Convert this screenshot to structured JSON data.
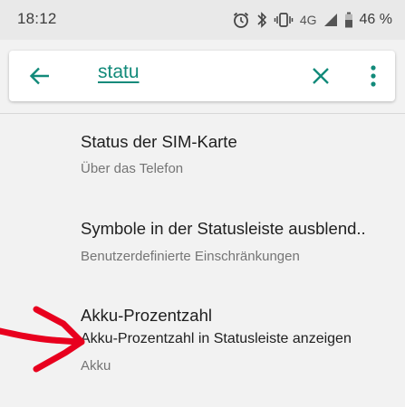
{
  "status_bar": {
    "time": "18:12",
    "icons": [
      "alarm-icon",
      "bluetooth-icon",
      "vibrate-icon",
      "signal-icon",
      "battery-icon"
    ],
    "network": "4G",
    "battery": "46 %"
  },
  "search": {
    "back_icon": "arrow-left-icon",
    "query": "statu",
    "clear_icon": "close-icon",
    "menu_icon": "more-vert-icon"
  },
  "results": [
    {
      "title": "Status der SIM-Karte",
      "path": "Über das Telefon"
    },
    {
      "title": "Symbole in der Statusleiste ausblend..",
      "path": "Benutzerdefinierte Einschränkungen"
    },
    {
      "title": "Akku-Prozentzahl",
      "summary": "Akku-Prozentzahl in Statusleiste anzeigen",
      "path": "Akku"
    }
  ],
  "colors": {
    "accent": "#128a7a",
    "annotation": "#e8001e",
    "background": "#f2f2f2",
    "status_bar": "#e9e9e9"
  }
}
